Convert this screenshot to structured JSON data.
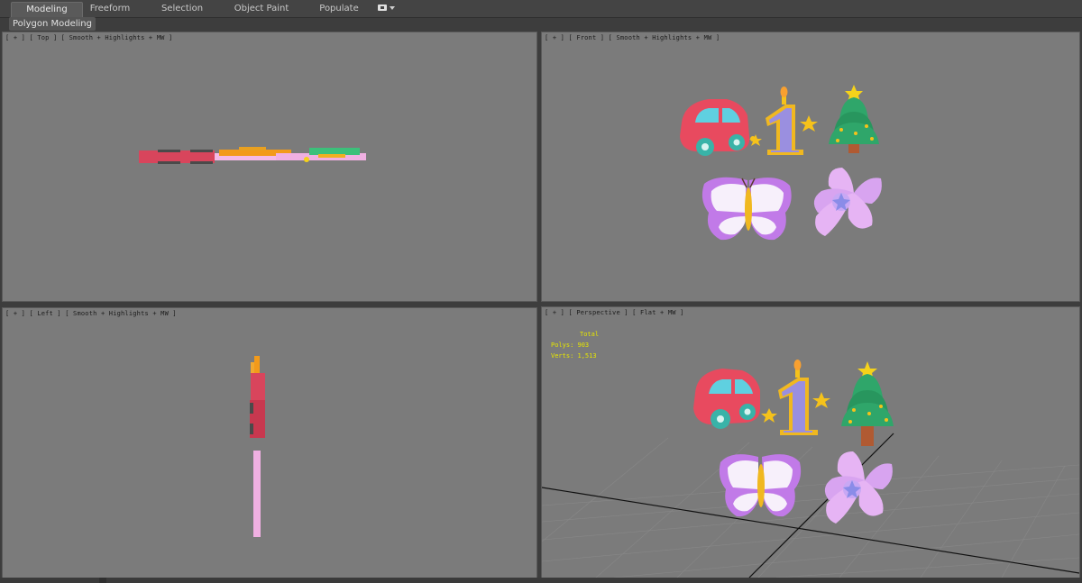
{
  "ribbon": {
    "tabs": [
      {
        "label": "Modeling",
        "active": true
      },
      {
        "label": "Freeform",
        "active": false
      },
      {
        "label": "Selection",
        "active": false
      },
      {
        "label": "Object Paint",
        "active": false
      },
      {
        "label": "Populate",
        "active": false
      }
    ],
    "panel_label": "Polygon Modeling"
  },
  "viewports": {
    "top": {
      "label": "[ + ] [ Top ] [ Smooth + Highlights + MW ]"
    },
    "front": {
      "label": "[ + ] [ Front ] [ Smooth + Highlights + MW ]"
    },
    "left": {
      "label": "[ + ] [ Left ] [ Smooth + Highlights + MW ]"
    },
    "perspective": {
      "label": "[ + ] [ Perspective ] [ Flat + MW ]",
      "stats": {
        "header": "Total",
        "polys": "Polys:  903",
        "verts": "Verts:  1,513"
      }
    }
  },
  "colors": {
    "viewport_bg": "#7b7b7b",
    "car_red": "#e84a5f",
    "candle_purple": "#9a8fe0",
    "star_yellow": "#f5c21a",
    "tree_green": "#2fa66a",
    "flower_pink": "#d8a4f0",
    "stats_yellow": "#e6e600"
  }
}
